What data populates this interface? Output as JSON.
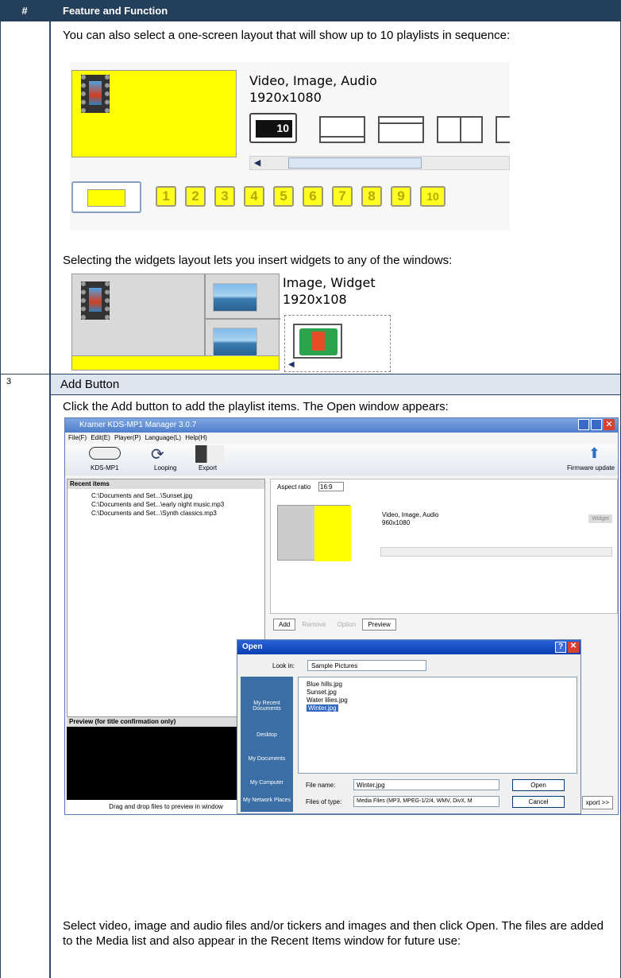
{
  "table": {
    "col1_header": "#",
    "col2_header": "Feature and Function"
  },
  "section2": {
    "intro": "You can also select a one-screen layout that will show up to 10 playlists in sequence:",
    "shot1": {
      "types": "Video, Image, Audio",
      "resolution": "1920x1080",
      "loop_badge": "10",
      "numbers": [
        "1",
        "2",
        "3",
        "4",
        "5",
        "6",
        "7",
        "8",
        "9",
        "10"
      ]
    },
    "widgets_text": "Selecting the widgets layout lets you insert widgets to any of the windows:",
    "shot2": {
      "types": "Image, Widget",
      "resolution": "1920x108"
    }
  },
  "section3": {
    "number": "3",
    "title": "Add Button",
    "intro": "Click the Add button to add the playlist items. The Open window appears:",
    "app": {
      "title": "Kramer KDS-MP1 Manager 3.0.7",
      "menu": [
        "File(F)",
        "Edit(E)",
        "Player(P)",
        "Language(L)",
        "Help(H)"
      ],
      "toolbar": {
        "device": "KDS-MP1",
        "looping": "Looping",
        "export": "Export",
        "firmware": "Firmware update"
      },
      "recent_header": "Recent items",
      "recent": [
        "C:\\Documents and Set...\\Sunset.jpg",
        "C:\\Documents and Set...\\early night music.mp3",
        "C:\\Documents and Set...\\Synth classics.mp3"
      ],
      "aspect_label": "Aspect ratio",
      "aspect_value": "16:9",
      "types": "Video, Image, Audio",
      "resolution": "960x1080",
      "widget_btn": "Widget",
      "buttons": {
        "add": "Add",
        "remove": "Remove",
        "option": "Option",
        "preview": "Preview"
      },
      "preview_header": "Preview (for title confirmation only)",
      "preview_hint": "Drag and drop files to preview in window",
      "export_btn": "xport >>"
    },
    "open": {
      "title": "Open",
      "look_in_label": "Look in:",
      "look_in_value": "Sample Pictures",
      "places": [
        "My Recent Documents",
        "Desktop",
        "My Documents",
        "My Computer",
        "My Network Places"
      ],
      "files": [
        "Blue hills.jpg",
        "Sunset.jpg",
        "Water lilies.jpg",
        "Winter.jpg"
      ],
      "file_name_label": "File name:",
      "file_name_value": "Winter.jpg",
      "file_type_label": "Files of type:",
      "file_type_value": "Media Files (MP3, MPEG-1/2/4, WMV, DivX, M",
      "open_btn": "Open",
      "cancel_btn": "Cancel"
    },
    "outro": "Select video, image and audio files and/or tickers and images and then click Open. The files are added to the Media list and also appear in the Recent Items window for future use:"
  }
}
